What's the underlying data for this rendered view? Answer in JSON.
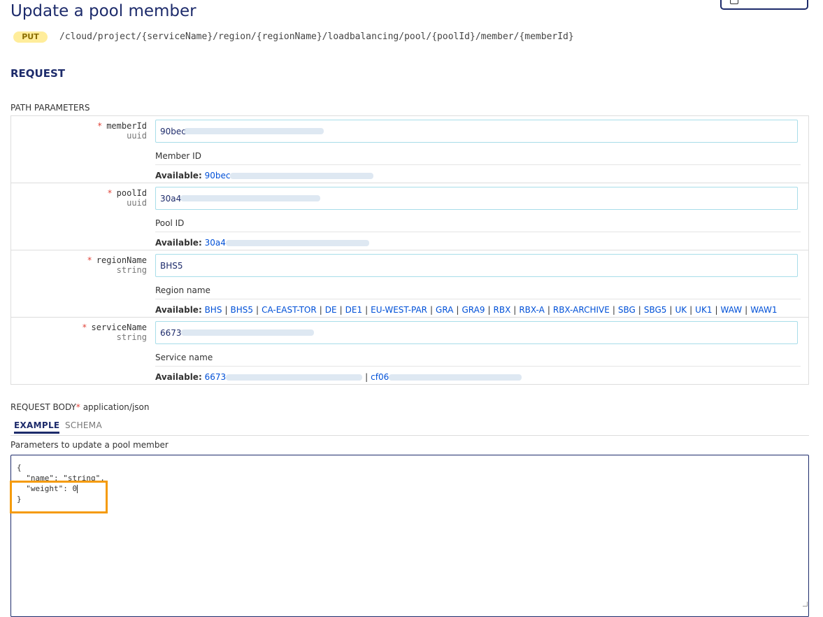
{
  "header": {
    "title": "Update a pool member",
    "method": "PUT",
    "path": "/cloud/project/{serviceName}/region/{regionName}/loadbalancing/pool/{poolId}/member/{memberId}"
  },
  "request": {
    "title": "REQUEST",
    "path_params_title": "PATH PARAMETERS",
    "available_label": "Available:",
    "required_marker": "*",
    "params": [
      {
        "name": "memberId",
        "type": "uuid",
        "value": "90bec",
        "description": "Member ID",
        "available": [
          "90bec"
        ]
      },
      {
        "name": "poolId",
        "type": "uuid",
        "value": "30a4",
        "description": "Pool ID",
        "available": [
          "30a4"
        ]
      },
      {
        "name": "regionName",
        "type": "string",
        "value": "BHS5",
        "description": "Region name",
        "available": [
          "BHS",
          "BHS5",
          "CA-EAST-TOR",
          "DE",
          "DE1",
          "EU-WEST-PAR",
          "GRA",
          "GRA9",
          "RBX",
          "RBX-A",
          "RBX-ARCHIVE",
          "SBG",
          "SBG5",
          "UK",
          "UK1",
          "WAW",
          "WAW1"
        ]
      },
      {
        "name": "serviceName",
        "type": "string",
        "value": "6673",
        "description": "Service name",
        "available": [
          "6673",
          "cf06"
        ]
      }
    ]
  },
  "body": {
    "title": "REQUEST BODY",
    "required_marker": "*",
    "content_type": "application/json",
    "tabs": [
      "EXAMPLE",
      "SCHEMA"
    ],
    "description": "Parameters to update a pool member",
    "code_lines": [
      "{",
      "  \"name\": \"string\",",
      "  \"weight\": 0",
      "}"
    ]
  },
  "colors": {
    "accent": "#1d2b6b",
    "link": "#0050d7",
    "highlight": "#f59b0c",
    "method_bg": "#ffed9b",
    "required": "#e0443a"
  }
}
